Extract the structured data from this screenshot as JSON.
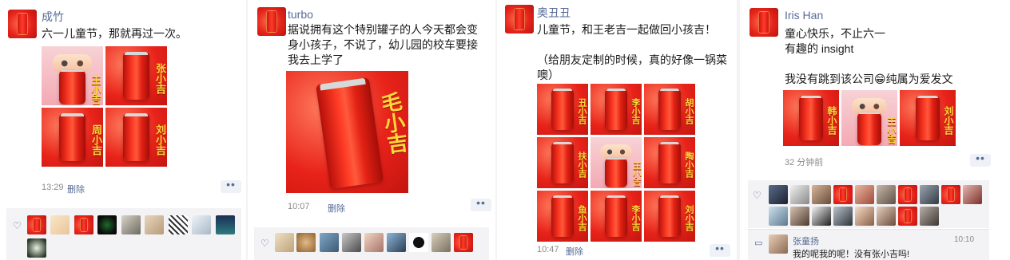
{
  "posts": [
    {
      "name": "成竹",
      "text": "六一儿童节，那就再过一次。",
      "tiles": [
        "",
        "张小吉",
        "周小吉",
        "刘小吉"
      ],
      "tile_labels_on_first": "王小吉",
      "time": "13:29",
      "delete_label": "删除"
    },
    {
      "name": "turbo",
      "text": "据说拥有这个特别罐子的人今天都会变身小孩子，不说了，幼儿园的校车要接我去上学了",
      "big_label": "毛小吉",
      "time": "10:07",
      "delete_label": "删除"
    },
    {
      "name": "奥丑丑",
      "text": "儿童节，和王老吉一起做回小孩吉！\n\n（给朋友定制的时候，真的好像一锅菜噢）",
      "tiles": [
        "丑小吉",
        "李小吉",
        "胡小吉",
        "扶小吉",
        "王小吉",
        "陶小吉",
        "鱼小吉",
        "李小吉",
        "刘小吉"
      ],
      "time": "10:47",
      "delete_label": "删除"
    },
    {
      "name": "Iris Han",
      "text": "童心快乐，不止六一\n有趣的 insight\n\n我没有跳到该公司😁纯属为爱发文",
      "tiles": [
        "韩小吉",
        "王小吉",
        "刘小吉"
      ],
      "time": "32 分钟前",
      "comment": {
        "name": "张童扬",
        "text": "我的呢我的呢！没有张小吉吗!",
        "time": "10:10"
      }
    }
  ],
  "icons": {
    "heart": "heart-icon",
    "more": "more-dots-icon",
    "comment": "comment-icon"
  }
}
